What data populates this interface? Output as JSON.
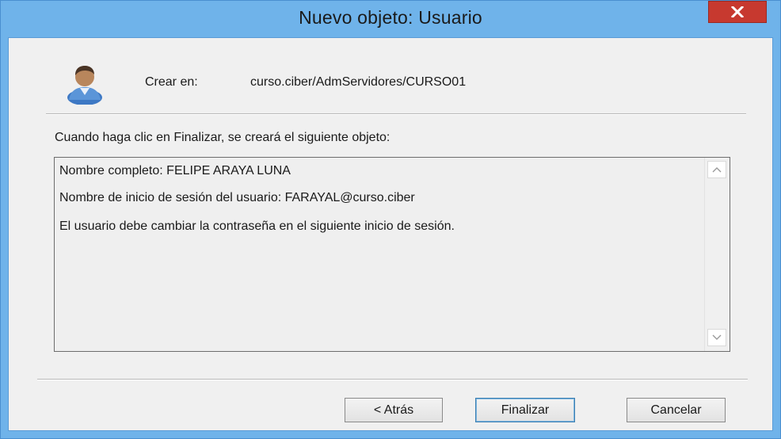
{
  "window": {
    "title": "Nuevo objeto: Usuario",
    "close_glyph": "✕"
  },
  "header": {
    "icon": "user-icon",
    "create_label": "Crear en:",
    "create_path": "curso.ciber/AdmServidores/CURSO01"
  },
  "intro_text": "Cuando haga clic en Finalizar, se creará el siguiente objeto:",
  "summary": {
    "lines": [
      "Nombre completo: FELIPE ARAYA LUNA",
      "Nombre de inicio de sesión del usuario: FARAYAL@curso.ciber",
      "El usuario debe cambiar la contraseña en el siguiente inicio de sesión."
    ]
  },
  "buttons": {
    "back": "< Atrás",
    "finish": "Finalizar",
    "cancel": "Cancelar"
  }
}
